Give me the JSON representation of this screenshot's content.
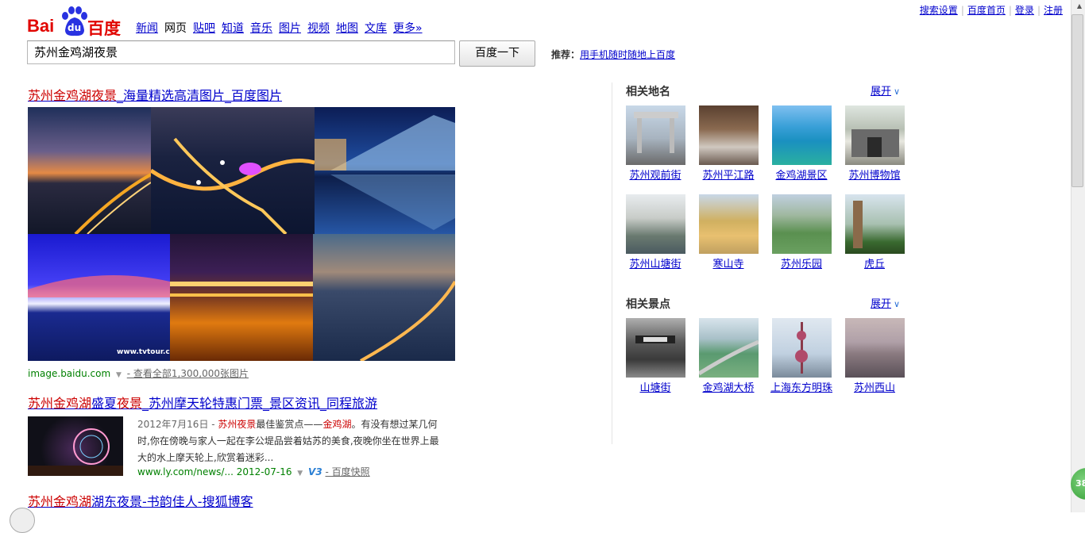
{
  "top_links": [
    "搜索设置",
    "百度首页",
    "登录",
    "注册"
  ],
  "logo": {
    "text_bai": "Bai",
    "text_du": "du",
    "text_cn": "百度"
  },
  "nav": [
    {
      "label": "新闻",
      "current": false
    },
    {
      "label": "网页",
      "current": true
    },
    {
      "label": "贴吧",
      "current": false
    },
    {
      "label": "知道",
      "current": false
    },
    {
      "label": "音乐",
      "current": false
    },
    {
      "label": "图片",
      "current": false
    },
    {
      "label": "视频",
      "current": false
    },
    {
      "label": "地图",
      "current": false
    },
    {
      "label": "文库",
      "current": false
    },
    {
      "label": "更多»",
      "current": false
    }
  ],
  "search": {
    "query": "苏州金鸡湖夜景",
    "button_label": "百度一下"
  },
  "recommend": {
    "label": "推荐：",
    "link": "用手机随时随地上百度"
  },
  "results": [
    {
      "title_em": "苏州金鸡湖夜景",
      "title_rest": "_海量精选高清图片_百度图片",
      "source": "image.baidu.com",
      "more": "- 查看全部1,300,000张图片",
      "watermark": "www.tvtour.c"
    },
    {
      "title_parts": [
        "苏州金鸡湖",
        "盛夏",
        "夜景",
        "_苏州摩天轮特惠门票_景区资讯_同程旅游"
      ],
      "date": "2012年7月16日 - ",
      "snippet_em1": "苏州夜景",
      "snippet_a": "最佳鉴赏点——",
      "snippet_em2": "金鸡湖",
      "snippet_b": "。有没有想过某几何时,你在傍晚与家人一起在李公堤品尝着姑苏的美食,夜晚你坐在世界上最大的水上摩天轮上,欣赏着迷彩...",
      "url": "www.ly.com/news/... 2012-07-16",
      "v_badge": "V3",
      "cache": "- 百度快照"
    },
    {
      "title_em": "苏州金鸡湖",
      "title_rest": "湖东夜景-书韵佳人-搜狐博客"
    }
  ],
  "right": {
    "section1": {
      "title": "相关地名",
      "expand": "展开",
      "items": [
        "苏州观前街",
        "苏州平江路",
        "金鸡湖景区",
        "苏州博物馆",
        "苏州山塘街",
        "寒山寺",
        "苏州乐园",
        "虎丘"
      ]
    },
    "section2": {
      "title": "相关景点",
      "expand": "展开",
      "items": [
        "山塘街",
        "金鸡湖大桥",
        "上海东方明珠",
        "苏州西山"
      ]
    }
  },
  "badge": "38"
}
